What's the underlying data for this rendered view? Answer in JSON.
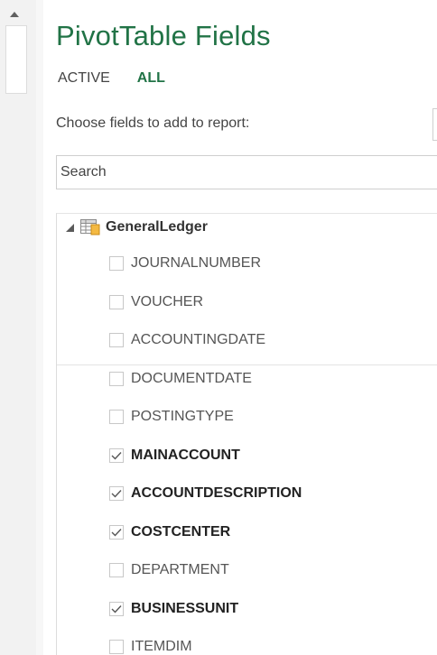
{
  "pane": {
    "title": "PivotTable Fields",
    "tabs": [
      {
        "label": "ACTIVE",
        "selected": false
      },
      {
        "label": "ALL",
        "selected": true
      }
    ],
    "choose_label": "Choose fields to add to report:",
    "search": {
      "placeholder": "Search",
      "value": ""
    }
  },
  "table": {
    "name": "GeneralLedger",
    "expanded": true,
    "fields": [
      {
        "label": "JOURNALNUMBER",
        "checked": false
      },
      {
        "label": "VOUCHER",
        "checked": false
      },
      {
        "label": "ACCOUNTINGDATE",
        "checked": false
      },
      {
        "label": "DOCUMENTDATE",
        "checked": false
      },
      {
        "label": "POSTINGTYPE",
        "checked": false
      },
      {
        "label": "MAINACCOUNT",
        "checked": true
      },
      {
        "label": "ACCOUNTDESCRIPTION",
        "checked": true
      },
      {
        "label": "COSTCENTER",
        "checked": true
      },
      {
        "label": "DEPARTMENT",
        "checked": false
      },
      {
        "label": "BUSINESSUNIT",
        "checked": true
      },
      {
        "label": "ITEMDIM",
        "checked": false
      }
    ]
  },
  "colors": {
    "accent": "#217346"
  },
  "icons": {
    "scroll_up": "triangle-up-icon",
    "expander": "triangle-expanded-icon",
    "table": "table-icon",
    "check": "checkmark-icon"
  }
}
